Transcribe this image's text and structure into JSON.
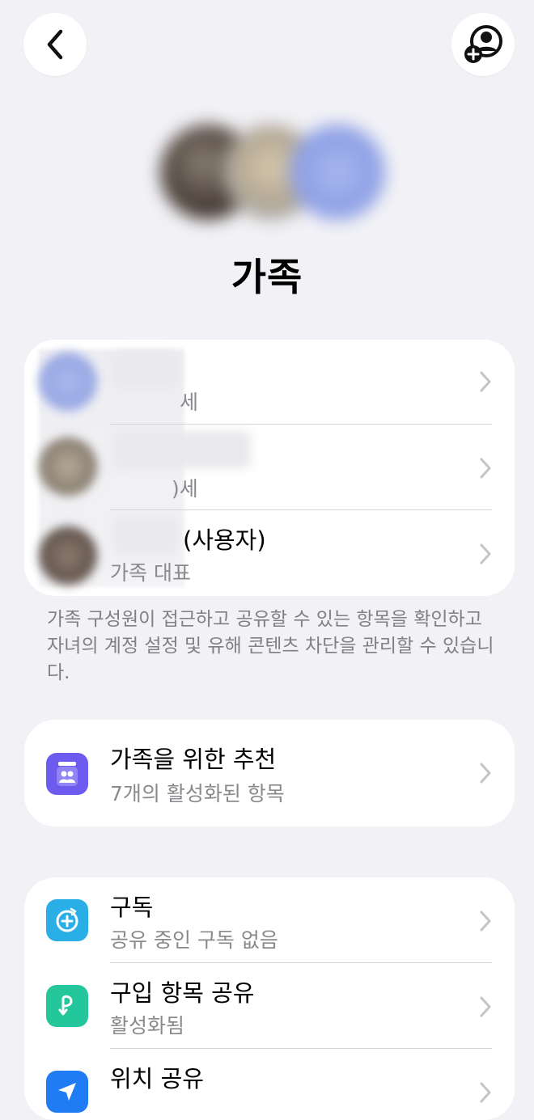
{
  "nav": {
    "back_icon": "chevron-left-icon",
    "add_member_icon": "person-add-icon"
  },
  "header": {
    "title": "가족"
  },
  "members": [
    {
      "name": "",
      "subtitle": "세"
    },
    {
      "name": "",
      "subtitle": ")세"
    },
    {
      "name": "(사용자)",
      "subtitle": "가족 대표"
    }
  ],
  "members_description": "가족 구성원이 접근하고 공유할 수 있는 항목을 확인하고 자녀의 계정 설정 및 유해 콘텐츠 차단을 관리할 수 있습니다.",
  "recommendations": {
    "title": "가족을 위한 추천",
    "subtitle": "7개의 활성화된 항목",
    "icon_color": "#6d5bf0"
  },
  "features": [
    {
      "title": "구독",
      "subtitle": "공유 중인 구독 없음",
      "icon": "subscription-plus-icon",
      "icon_color": "#2aaee6"
    },
    {
      "title": "구입 항목 공유",
      "subtitle": "활성화됨",
      "icon": "purchase-sharing-icon",
      "icon_color": "#23c79b"
    },
    {
      "title": "위치 공유",
      "subtitle": "",
      "icon": "location-arrow-icon",
      "icon_color": "#1f7cf5"
    }
  ],
  "colors": {
    "background": "#f2f2f6",
    "card": "#ffffff",
    "secondary_text": "#8a8a8e",
    "chevron": "#c4c4c7"
  }
}
